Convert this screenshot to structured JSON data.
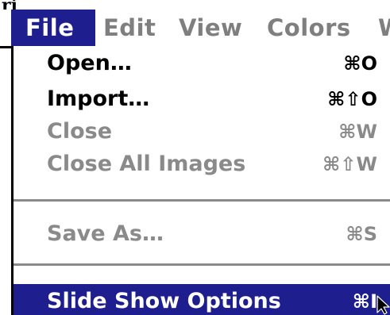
{
  "top_fragment": "ri",
  "menubar": {
    "menus": [
      {
        "label": "File",
        "state": "active"
      },
      {
        "label": "Edit",
        "state": "disabled"
      },
      {
        "label": "View",
        "state": "disabled"
      },
      {
        "label": "Colors",
        "state": "disabled"
      },
      {
        "label": "W",
        "state": "disabled"
      }
    ]
  },
  "file_menu": {
    "items": [
      {
        "label": "Open…",
        "shortcut": "⌘O",
        "state": "enabled"
      },
      {
        "label": "Import…",
        "shortcut": "⌘⇧O",
        "state": "enabled"
      },
      {
        "label": "Close",
        "shortcut": "⌘W",
        "state": "disabled"
      },
      {
        "label": "Close All Images",
        "shortcut": "⌘⇧W",
        "state": "disabled"
      },
      {
        "label": "Save As…",
        "shortcut": "⌘S",
        "state": "disabled"
      },
      {
        "label": "Slide Show Options",
        "shortcut": "⌘I",
        "state": "selected"
      }
    ]
  },
  "colors": {
    "highlight": "#1e1e8e",
    "disabled_text": "#8a8a8a",
    "enabled_text": "#000000",
    "background": "#ffffff"
  },
  "icons": {
    "cursor": "pointer-cursor-icon"
  }
}
